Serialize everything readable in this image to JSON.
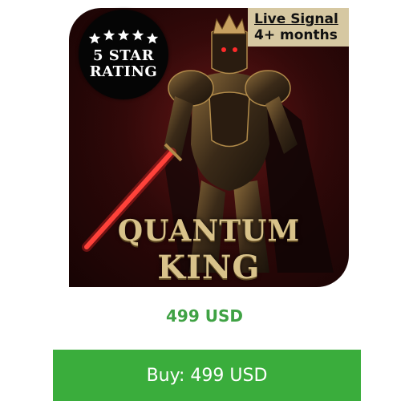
{
  "product": {
    "rating_badge": {
      "stars": 5,
      "line1": "5 STAR",
      "line2": "RATING"
    },
    "signal_badge": {
      "title": "Live Signal",
      "subtitle": "4+ months"
    },
    "title": {
      "line1": "QUANTUM",
      "line2": "KING"
    },
    "price_text": "499 USD",
    "buy_label": "Buy: 499 USD",
    "icons": [
      "star-icon",
      "knight-figure",
      "sword"
    ]
  },
  "colors": {
    "price": "#3fa244",
    "buy_button": "#3aad3c",
    "signal_badge": "#d6c8a2",
    "rating_badge": "#050505",
    "title_gold": "#d8c28a",
    "background_red": "#3a0a0a",
    "glow_red": "#ff2a2a"
  }
}
